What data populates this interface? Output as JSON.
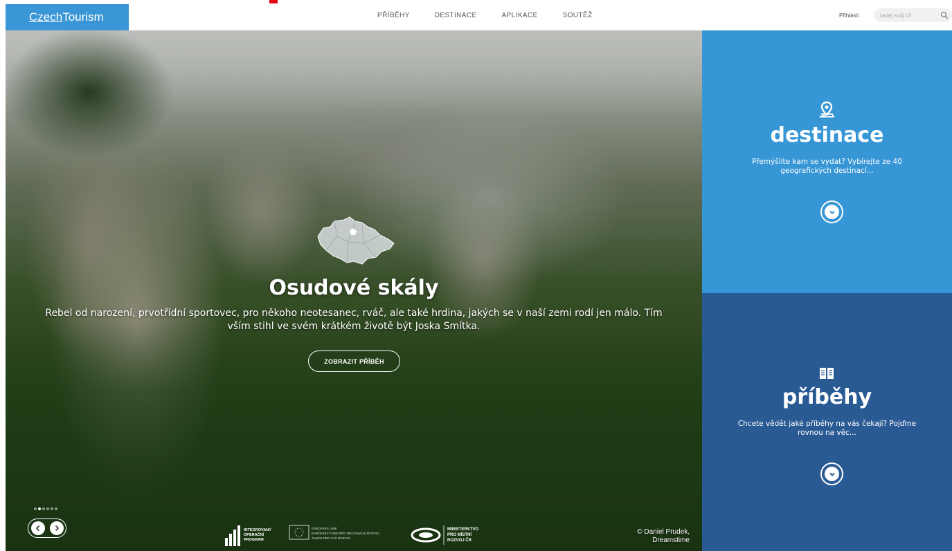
{
  "header": {
    "logo": {
      "part1": "Czech",
      "part2": "Tourism"
    },
    "nav": [
      "PŘÍBĚHY",
      "DESTINACE",
      "APLIKACE",
      "SOUTĚŽ"
    ],
    "login": "Přihlásit",
    "search": {
      "placeholder": "zadej svůj cíl",
      "icon": "search-icon"
    }
  },
  "hero": {
    "title": "Osudové skály",
    "description": "Rebel od narození, prvotřídní sportovec, pro někoho neotesanec, rváč, ale také hrdina, jakých se v naší zemi rodí jen málo. Tím vším stihl ve svém krátkém životě být Joska Smítka.",
    "button": "ZOBRAZIT PŘÍBĚH",
    "credit_line1": "© Daniel Prudek,",
    "credit_line2": "Dreamstime",
    "slides": {
      "count": 6,
      "active": 2
    },
    "logos": {
      "iop": [
        "INTEGROVANÝ",
        "OPERAČNÍ",
        "PROGRAM"
      ],
      "eu": [
        "EVROPSKÁ UNIE",
        "EVROPSKÝ FOND PRO REGIONÁLNÍ ROZVOJ",
        "ŠANCE PRO VÁŠ ROZVOJ"
      ],
      "mmr": [
        "MINISTERSTVO",
        "PRO MÍSTNÍ",
        "ROZVOJ ČR"
      ]
    }
  },
  "panels": {
    "destinations": {
      "icon": "map-pin-icon",
      "title": "destinace",
      "text": "Přemýšlíte kam se vydat? Vybírejte ze 40 geografických destinací...",
      "color": "#3696d6"
    },
    "stories": {
      "icon": "open-book-icon",
      "title": "příběhy",
      "text": "Chcete vědět jaké příběhy na vás čekají? Pojďme rovnou na věc...",
      "color": "#2a5a94"
    }
  },
  "colors": {
    "brand_blue": "#3a96d6",
    "accent_red": "#e30613"
  }
}
